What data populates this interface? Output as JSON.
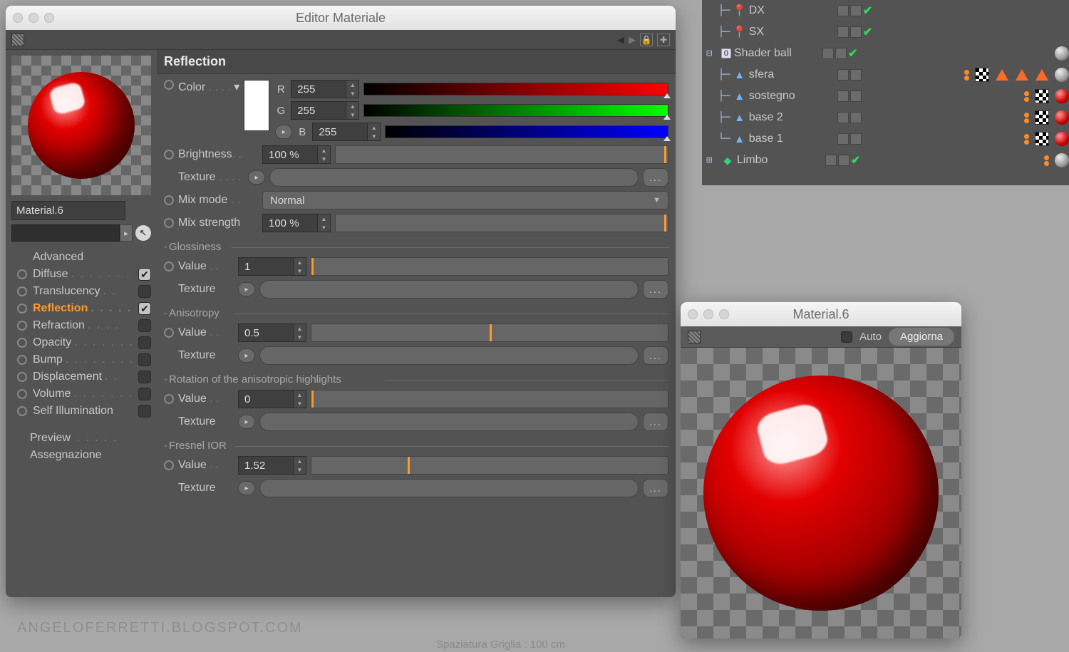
{
  "editor": {
    "title": "Editor Materiale",
    "material_name": "Material.6",
    "section": "Reflection",
    "channels": [
      {
        "label": "Advanced",
        "dots": "",
        "hasRadio": false,
        "checked": null
      },
      {
        "label": "Diffuse",
        "dots": ". . . . . . .",
        "hasRadio": true,
        "checked": true
      },
      {
        "label": "Translucency",
        "dots": ". .",
        "hasRadio": true,
        "checked": false
      },
      {
        "label": "Reflection",
        "dots": ". . . . .",
        "hasRadio": true,
        "checked": true,
        "active": true
      },
      {
        "label": "Refraction",
        "dots": ". . . .",
        "hasRadio": true,
        "checked": false
      },
      {
        "label": "Opacity",
        "dots": ". . . . . . .",
        "hasRadio": true,
        "checked": false
      },
      {
        "label": "Bump",
        "dots": ". . . . . . . .",
        "hasRadio": true,
        "checked": false
      },
      {
        "label": "Displacement",
        "dots": ". .",
        "hasRadio": true,
        "checked": false
      },
      {
        "label": "Volume",
        "dots": ". . . . . . .",
        "hasRadio": true,
        "checked": false
      },
      {
        "label": "Self Illumination",
        "dots": "",
        "hasRadio": true,
        "checked": false
      }
    ],
    "sub_items": [
      {
        "label": "Preview",
        "dots": ". . . . ."
      },
      {
        "label": "Assegnazione",
        "dots": ""
      }
    ],
    "color": {
      "label": "Color",
      "dots": ". . . .",
      "R": "255",
      "G": "255",
      "B": "255"
    },
    "brightness": {
      "label": "Brightness",
      "dots": ". .",
      "value": "100 %",
      "slider": 100
    },
    "texture_label": "Texture",
    "texture_dots": ". . . .",
    "mixmode": {
      "label": "Mix mode",
      "dots": ". .",
      "value": "Normal"
    },
    "mixstrength": {
      "label": "Mix strength",
      "value": "100 %",
      "slider": 100
    },
    "glossiness": {
      "header": "Glossiness",
      "value_label": "Value",
      "value": "1",
      "slider": 0
    },
    "anisotropy": {
      "header": "Anisotropy",
      "value_label": "Value",
      "value": "0.5",
      "slider": 50
    },
    "rotation": {
      "header": "Rotation of the anisotropic highlights",
      "value_label": "Value",
      "value": "0",
      "slider": 0
    },
    "fresnel": {
      "header": "Fresnel IOR",
      "value_label": "Value",
      "value": "1.52",
      "slider": 27
    }
  },
  "outliner": {
    "rows": [
      {
        "indent": "  ├─",
        "iconClass": "pin",
        "iconGlyph": "📍",
        "name": "DX",
        "mid": true,
        "tags": []
      },
      {
        "indent": "  ├─",
        "iconClass": "pin",
        "iconGlyph": "📍",
        "name": "SX",
        "mid": true,
        "tags": []
      },
      {
        "indent": "⊟ ",
        "iconClass": "",
        "iconGlyph": "",
        "badge": "0",
        "name": "Shader ball",
        "mid": true,
        "tags": [
          "gray"
        ]
      },
      {
        "indent": "  ├─",
        "iconClass": "mesh",
        "iconGlyph": "▲",
        "name": "sfera",
        "mid": false,
        "tags": [
          "dots",
          "chk",
          "tri",
          "tri",
          "tri",
          "gray"
        ]
      },
      {
        "indent": "  ├─",
        "iconClass": "mesh",
        "iconGlyph": "▲",
        "name": "sostegno",
        "mid": false,
        "tags": [
          "dots",
          "chk",
          "red"
        ]
      },
      {
        "indent": "  ├─",
        "iconClass": "mesh",
        "iconGlyph": "▲",
        "name": "base 2",
        "mid": false,
        "tags": [
          "dots",
          "chk",
          "red"
        ]
      },
      {
        "indent": "  └─",
        "iconClass": "mesh",
        "iconGlyph": "▲",
        "name": "base 1",
        "mid": false,
        "tags": [
          "dots",
          "chk",
          "red"
        ]
      },
      {
        "indent": "⊞ ",
        "iconClass": "cube",
        "iconGlyph": "◆",
        "name": "Limbo",
        "mid": true,
        "tags": [
          "dots",
          "gray"
        ]
      }
    ]
  },
  "preview": {
    "title": "Material.6",
    "auto": "Auto",
    "refresh": "Aggiorna"
  },
  "watermark": "ANGELOFERRETTI.BLOGSPOT.COM",
  "footerinfo": "Spaziatura Griglia : 100 cm"
}
